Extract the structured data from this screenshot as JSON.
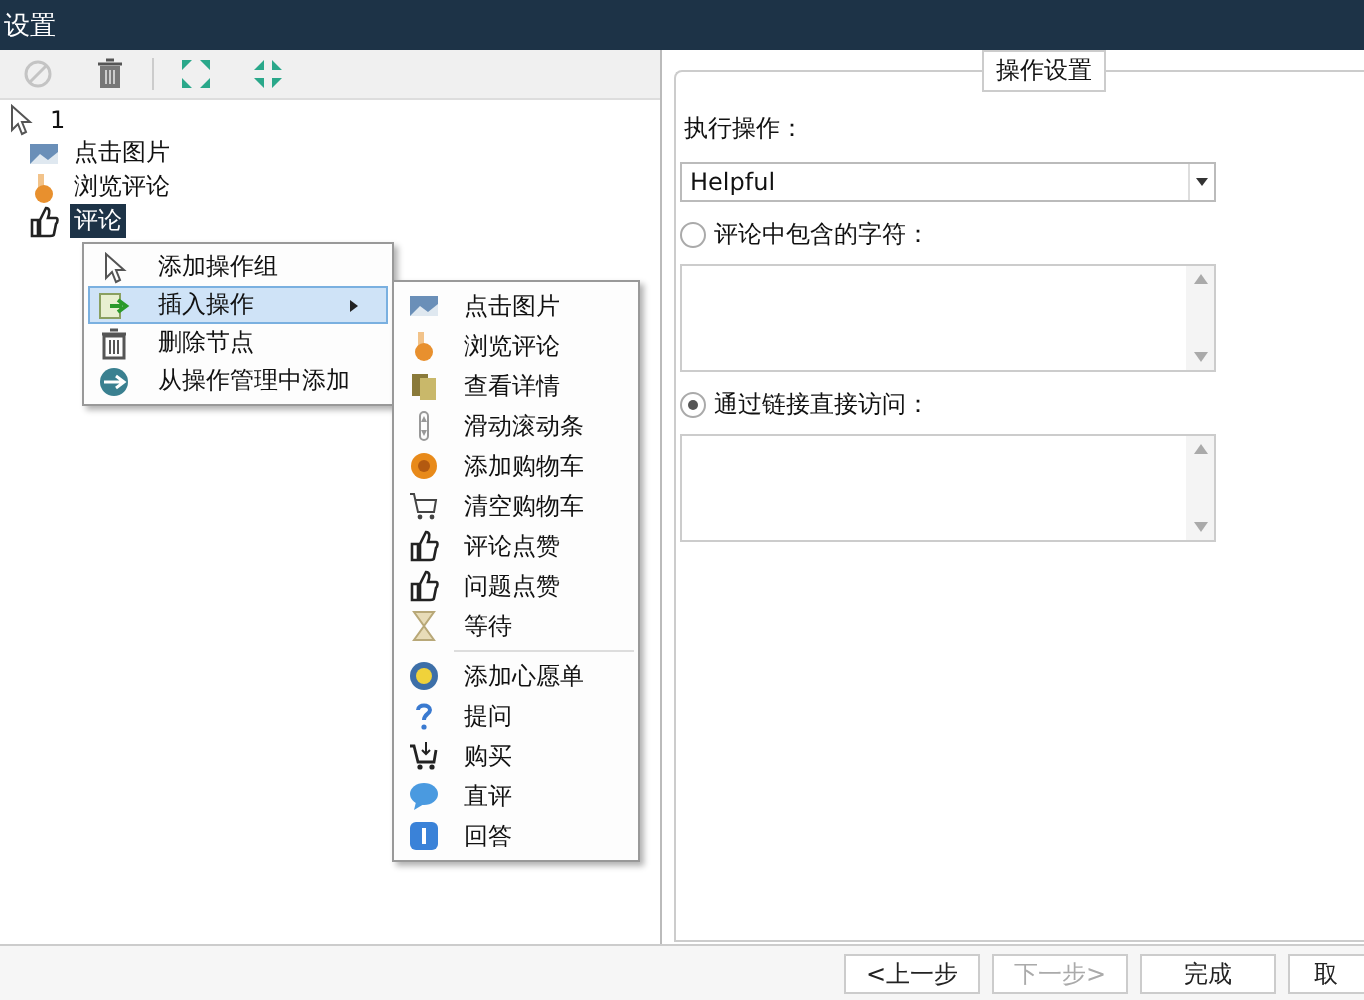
{
  "window": {
    "title": "设置"
  },
  "toolbar": [
    {
      "kind": "disable",
      "disabled": true
    },
    {
      "kind": "delete",
      "disabled": false
    },
    {
      "kind": "expand",
      "disabled": false
    },
    {
      "kind": "collapse",
      "disabled": false
    }
  ],
  "tree": {
    "label": "1",
    "children": [
      {
        "label": "点击图片",
        "selected": false
      },
      {
        "label": "浏览评论",
        "selected": false
      },
      {
        "label": "评论",
        "selected": true
      }
    ]
  },
  "context_menu": [
    {
      "label": "添加操作组",
      "selected": false,
      "submenu": false
    },
    {
      "label": "插入操作",
      "selected": true,
      "submenu": true
    },
    {
      "label": "删除节点",
      "selected": false,
      "submenu": false
    },
    {
      "label": "从操作管理中添加",
      "selected": false,
      "submenu": false
    }
  ],
  "submenu": [
    [
      {
        "label": "点击图片"
      },
      {
        "label": "浏览评论"
      },
      {
        "label": "查看详情"
      },
      {
        "label": "滑动滚动条"
      },
      {
        "label": "添加购物车"
      },
      {
        "label": "清空购物车"
      },
      {
        "label": "评论点赞"
      },
      {
        "label": "问题点赞"
      },
      {
        "label": "等待"
      }
    ],
    [
      {
        "label": "添加心愿单"
      },
      {
        "label": "提问"
      },
      {
        "label": "购买"
      },
      {
        "label": "直评"
      },
      {
        "label": "回答"
      }
    ]
  ],
  "settings": {
    "legend": "操作设置",
    "action_label": "执行操作：",
    "action_value": "Helpful",
    "options": [
      {
        "label": "评论中包含的字符：",
        "selected": false
      },
      {
        "label": "通过链接直接访问：",
        "selected": true
      }
    ]
  },
  "buttons": [
    {
      "label": "<上一步",
      "disabled": false
    },
    {
      "label": "下一步>",
      "disabled": true
    },
    {
      "label": "完成",
      "disabled": false
    },
    {
      "label": "取",
      "disabled": false
    }
  ]
}
